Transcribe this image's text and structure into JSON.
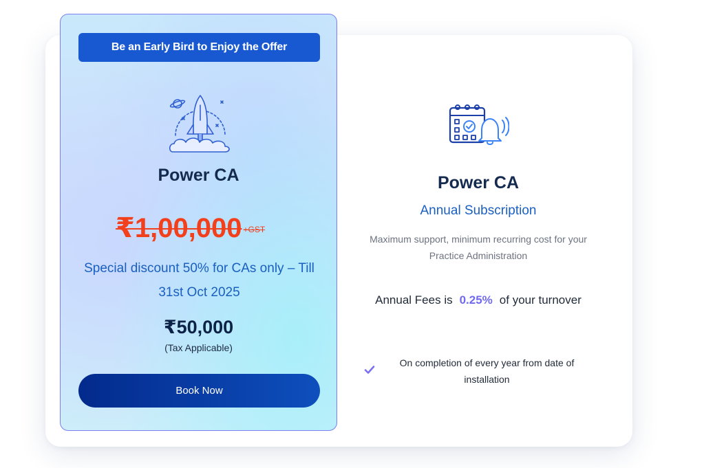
{
  "offer": {
    "banner": "Be an Early Bird to Enjoy the Offer",
    "icon": "rocket-icon",
    "title": "Power CA",
    "old_price": "₹1,00,000",
    "old_price_suffix": "+GST",
    "discount": "Special discount 50% for CAs only – Till 31st Oct 2025",
    "new_price": "₹50,000",
    "tax_note": "(Tax Applicable)",
    "button": "Book Now"
  },
  "subscription": {
    "icon": "calendar-bell-icon",
    "title": "Power CA",
    "type": "Annual Subscription",
    "description": "Maximum support, minimum recurring cost for your Practice Administration",
    "fees_prefix": "Annual Fees is",
    "fees_value": "0.25%",
    "fees_suffix": "of your turnover",
    "note_icon": "check-icon",
    "note": "On completion of every year from date of installation"
  },
  "colors": {
    "brand_blue": "#1859d2",
    "strike_red": "#f2401d",
    "accent_purple": "#6f6af0",
    "navy": "#142a4f"
  }
}
